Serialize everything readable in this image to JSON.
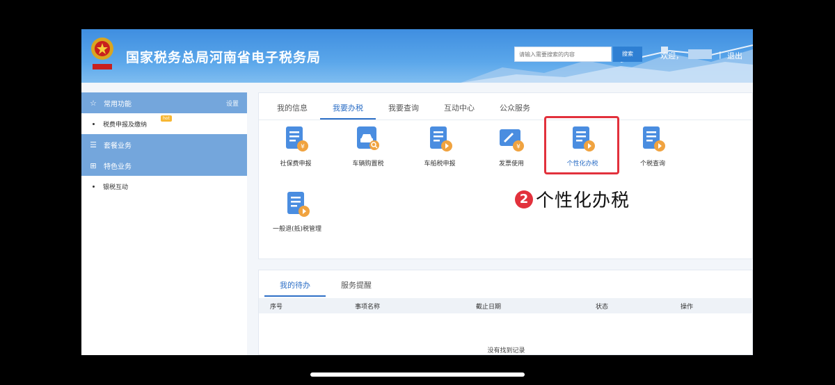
{
  "header": {
    "site_title": "国家税务总局河南省电子税务局",
    "search_placeholder": "请输入需要搜索的内容",
    "search_button": "搜索",
    "welcome": "欢迎，",
    "separator": "|",
    "logout": "退出"
  },
  "sidebar": {
    "groups": [
      {
        "label": "常用功能",
        "icon": "star-icon",
        "setting": "设置"
      },
      {
        "label": "套餐业务",
        "icon": "layers-icon"
      },
      {
        "label": "特色业务",
        "icon": "grid-icon"
      }
    ],
    "items": [
      {
        "label": "税费申报及缴纳",
        "badge": "hot"
      },
      {
        "label": "银税互动"
      }
    ]
  },
  "main": {
    "tabs": [
      {
        "label": "我的信息",
        "active": false
      },
      {
        "label": "我要办税",
        "active": true
      },
      {
        "label": "我要查询",
        "active": false
      },
      {
        "label": "互动中心",
        "active": false
      },
      {
        "label": "公众服务",
        "active": false
      }
    ],
    "tiles": [
      {
        "label": "社保费申报",
        "icon": "document-yuan-icon"
      },
      {
        "label": "车辆购置税",
        "icon": "car-search-icon"
      },
      {
        "label": "车船税申报",
        "icon": "document-coin-icon"
      },
      {
        "label": "发票使用",
        "icon": "invoice-pen-icon"
      },
      {
        "label": "个性化办税",
        "icon": "document-coin-icon",
        "highlighted": true
      },
      {
        "label": "个税查询",
        "icon": "document-coin-icon"
      },
      {
        "label": "一般退(抵)税管理",
        "icon": "document-coin-icon"
      }
    ],
    "annotation": {
      "number": "2",
      "text": "个性化办税"
    }
  },
  "todo": {
    "tabs": [
      {
        "label": "我的待办",
        "active": true
      },
      {
        "label": "服务提醒",
        "active": false
      }
    ],
    "columns": [
      "序号",
      "事项名称",
      "截止日期",
      "状态",
      "操作"
    ],
    "empty_text": "没有找到记录"
  },
  "colors": {
    "header_blue": "#3f8ee0",
    "accent_blue": "#2d6fc6",
    "sidebar_blue": "#74a6dc",
    "highlight_red": "#e2313c",
    "coin_orange": "#f0a340"
  }
}
